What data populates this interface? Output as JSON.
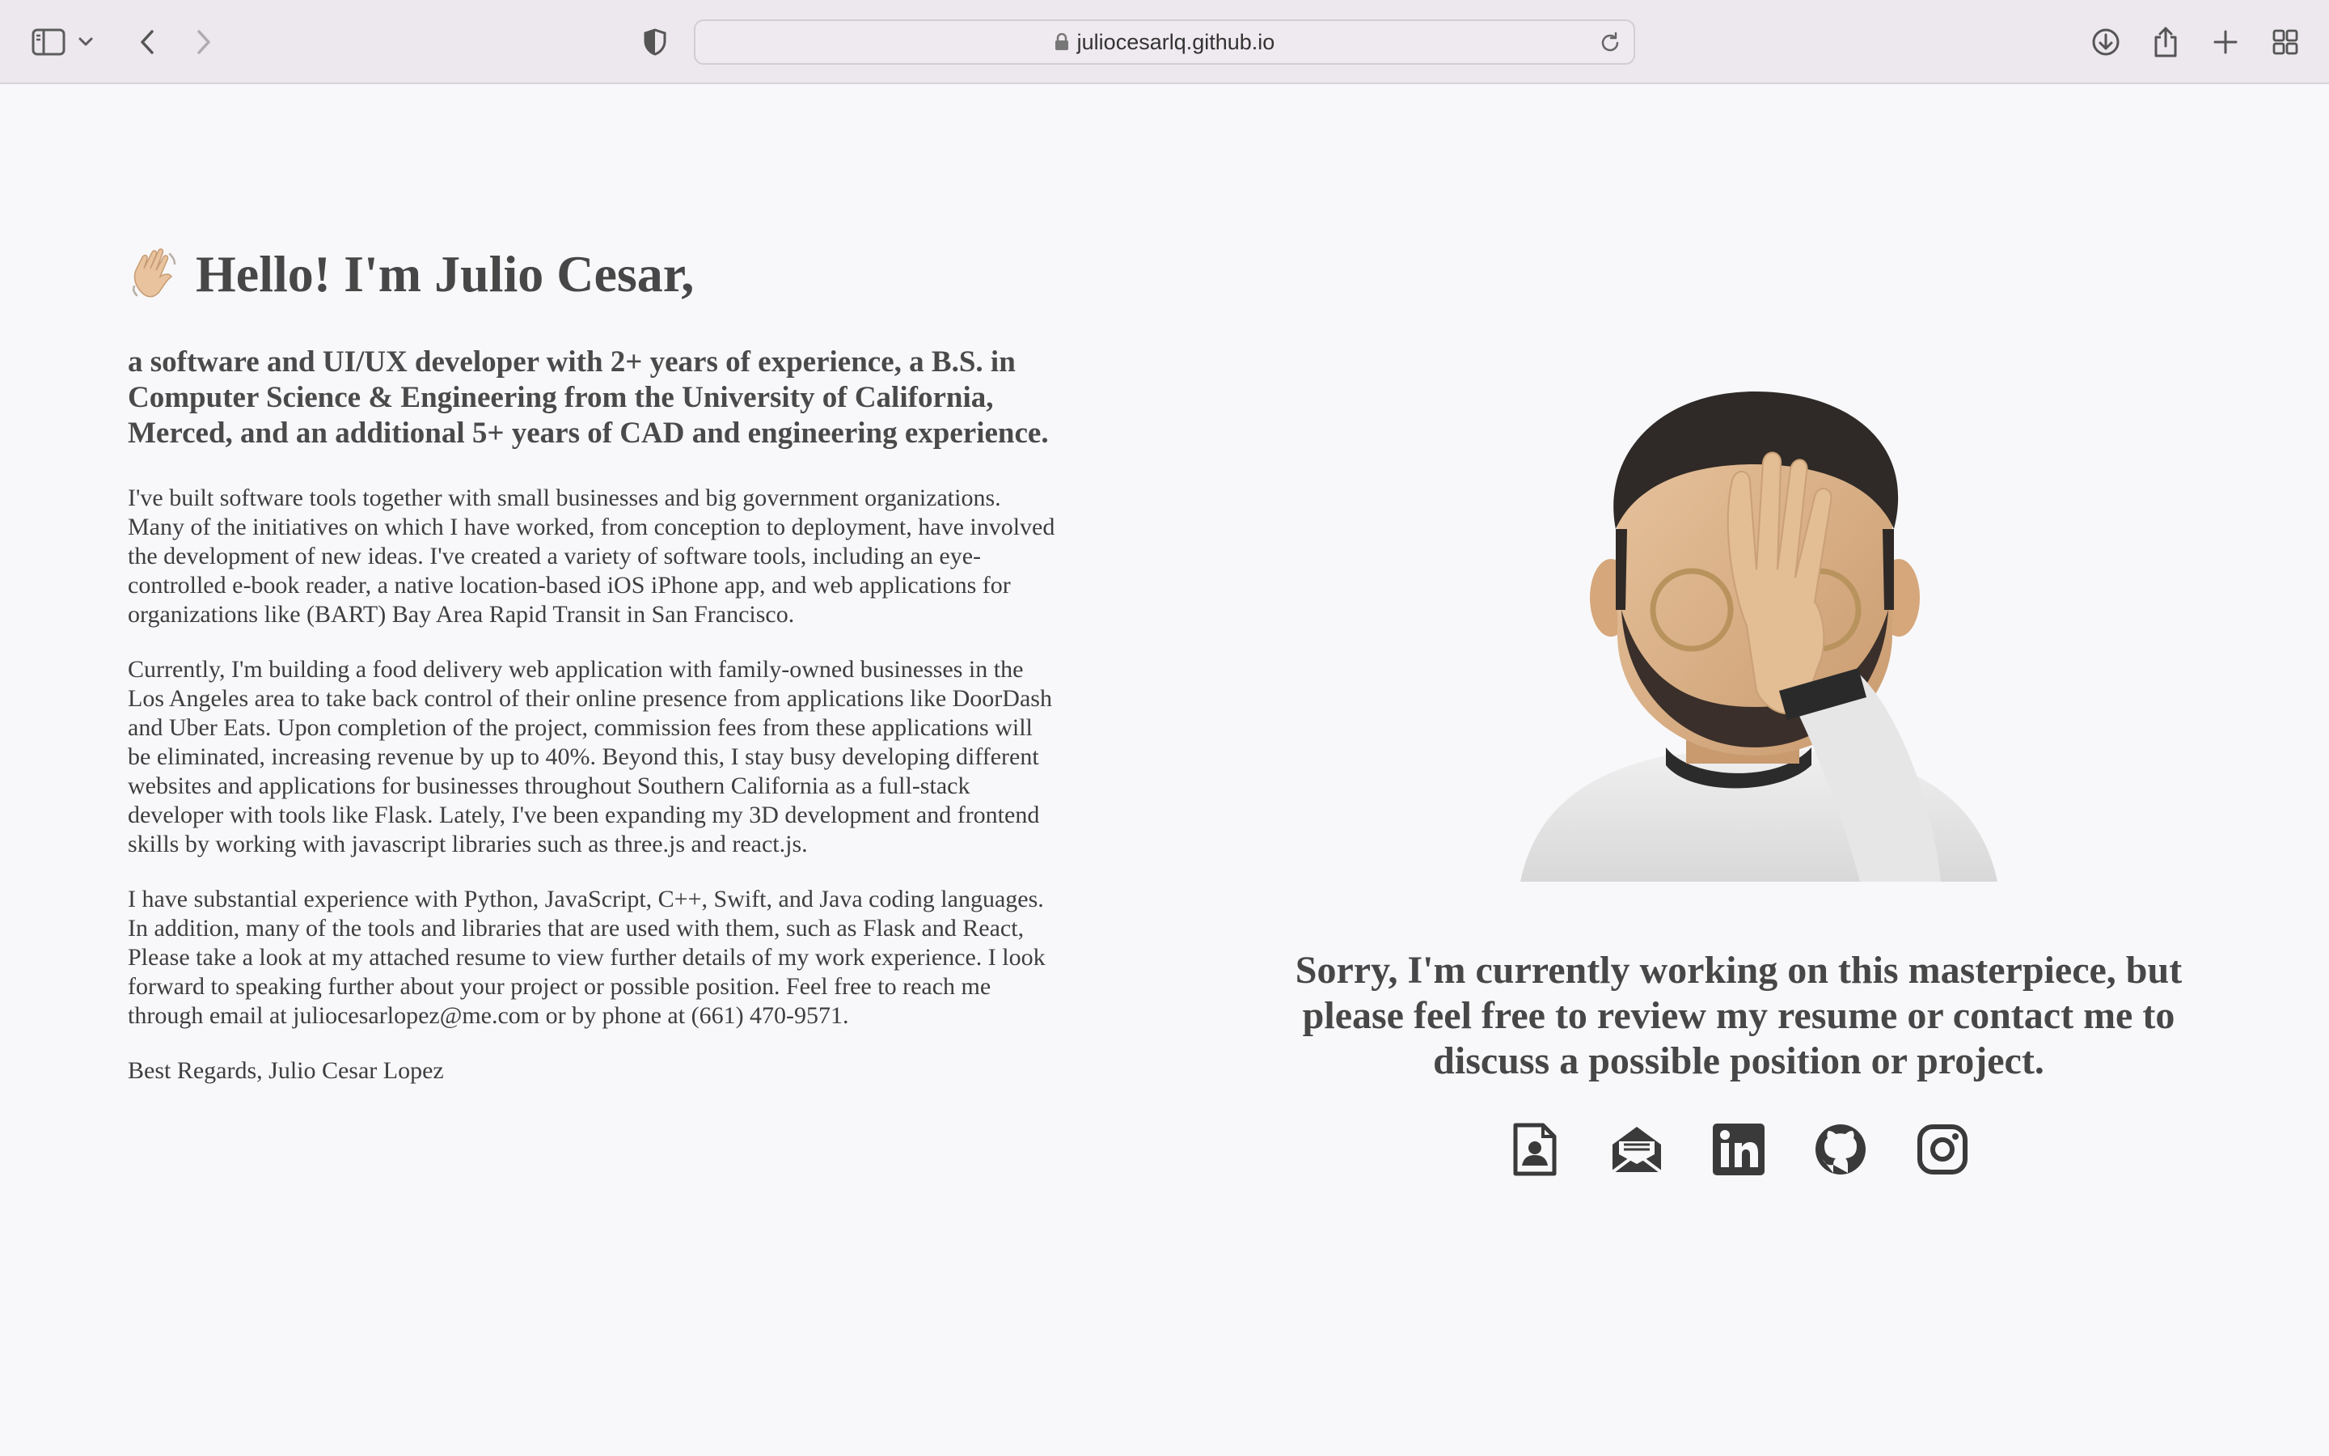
{
  "browser": {
    "url": "juliocesarlq.github.io",
    "icons": [
      "sidebar-icon",
      "chevron-down-icon",
      "back-icon",
      "forward-icon",
      "privacy-shield-icon",
      "lock-icon",
      "reload-icon",
      "download-icon",
      "share-icon",
      "new-tab-icon",
      "tab-overview-icon"
    ]
  },
  "intro": {
    "greeting": "Hello! I'm Julio Cesar,",
    "greeting_icon": "waving-hand-icon",
    "lead": "a software and UI/UX developer with 2+ years of experience, a B.S. in Computer Science & Engineering from the University of California, Merced, and an additional 5+ years of CAD and engineering experience.",
    "paragraphs": [
      "I've built software tools together with small businesses and big government organizations. Many of the initiatives on which I have worked, from conception to deployment, have involved the development of new ideas. I've created a variety of software tools, including an eye-controlled e-book reader, a native location-based iOS iPhone app, and web applications for organizations like (BART) Bay Area Rapid Transit in San Francisco.",
      "Currently, I'm building a food delivery web application with family-owned businesses in the Los Angeles area to take back control of their online presence from applications like DoorDash and Uber Eats. Upon completion of the project, commission fees from these applications will be eliminated, increasing revenue by up to 40%. Beyond this, I stay busy developing different websites and applications for businesses throughout Southern California as a full-stack developer with tools like Flask. Lately, I've been expanding my 3D development and frontend skills by working with javascript libraries such as three.js and react.js.",
      "I have substantial experience with Python, JavaScript, C++, Swift, and Java coding languages. In addition, many of the tools and libraries that are used with them, such as Flask and React, Please take a look at my attached resume to view further details of my work experience. I look forward to speaking further about your project or possible position. Feel free to reach me through email at juliocesarlopez@me.com or by phone at (661) 470-9571.",
      "Best Regards, Julio Cesar Lopez"
    ]
  },
  "side": {
    "avatar_icon": "facepalm-avatar",
    "message": "Sorry, I'm currently working on this masterpiece, but please feel free to review my resume or contact me to discuss a possible position or project.",
    "links": [
      "resume-icon",
      "mail-icon",
      "linkedin-icon",
      "github-icon",
      "instagram-icon"
    ]
  },
  "colors": {
    "toolbar": "#ede8ee",
    "page_background": "#f8f8fa",
    "text": "#444444",
    "icon": "#3a3a3a"
  }
}
